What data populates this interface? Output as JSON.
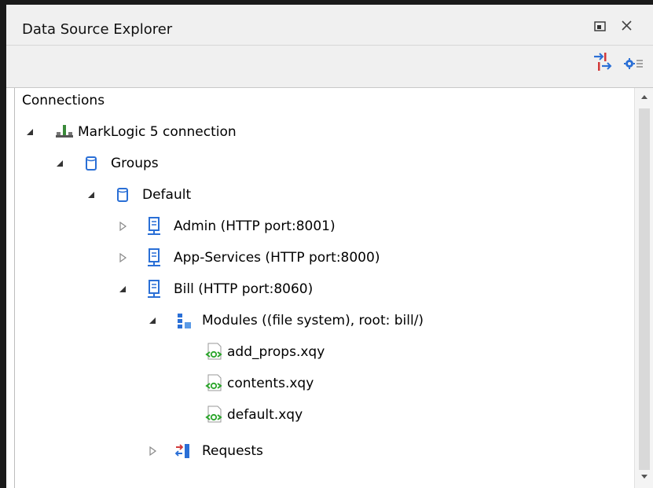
{
  "window": {
    "title": "Data Source Explorer"
  },
  "icons": {
    "restore": "restore-icon",
    "close": "close-icon",
    "link": "link-with-editor-icon",
    "settings": "settings-icon"
  },
  "tree": {
    "root_label": "Connections",
    "connection": "MarkLogic 5 connection",
    "groups": "Groups",
    "default": "Default",
    "servers": [
      "Admin (HTTP port:8001)",
      "App-Services (HTTP port:8000)",
      "Bill (HTTP port:8060)"
    ],
    "modules": "Modules ((file system), root: bill/)",
    "files": [
      "add_props.xqy",
      "contents.xqy",
      "default.xqy"
    ],
    "requests": "Requests"
  },
  "colors": {
    "accent_blue": "#2a6fd6",
    "xquery_green": "#2aa52a",
    "requests_red": "#d23a3a"
  }
}
